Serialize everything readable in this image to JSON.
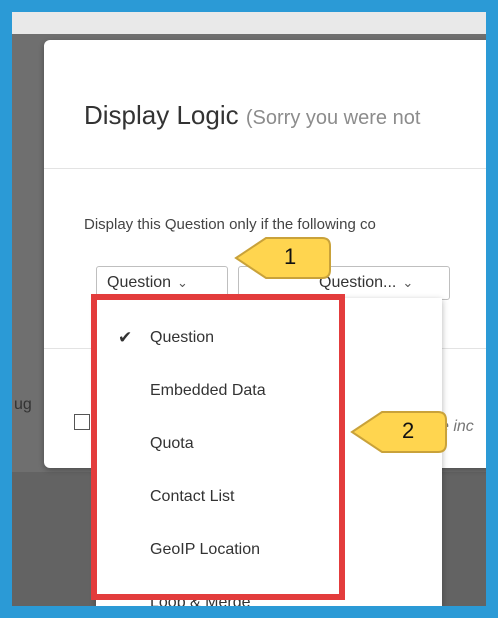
{
  "background": {
    "left_label": "ug"
  },
  "modal": {
    "title": "Display Logic",
    "subtitle": "(Sorry you were not",
    "description": "Display this Question only if the following co",
    "question_select": "Question",
    "question_picker": "Question...",
    "include_text": "e inc"
  },
  "menu": {
    "items": [
      {
        "label": "Question",
        "selected": "✔"
      },
      {
        "label": "Embedded Data"
      },
      {
        "label": "Quota"
      },
      {
        "label": "Contact List"
      },
      {
        "label": "GeoIP Location"
      },
      {
        "label": "Loop & Merge"
      }
    ]
  },
  "callouts": {
    "one": "1",
    "two": "2"
  },
  "colors": {
    "frame_border": "#2b9ad6",
    "highlight": "#e33c3c",
    "callout_fill": "#ffd54f"
  }
}
